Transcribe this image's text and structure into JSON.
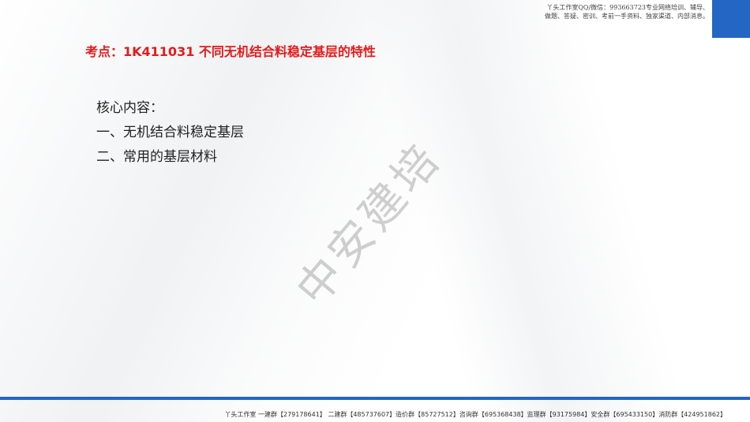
{
  "header": {
    "note_line1": "丫头工作室QQ/微信：993663723专业网络培训、辅导、",
    "note_line2": "做题、答疑、密训、考前一手资料、独家渠道、内部消息。"
  },
  "title": "考点：1K411031 不同无机结合料稳定基层的特性",
  "content": {
    "items": [
      "核心内容：",
      "一、无机结合料稳定基层",
      "二、常用的基层材料"
    ]
  },
  "watermark": "中安建培",
  "footer": "丫头工作室  一建群【279178641】 二建群【485737607】造价群【85727512】咨询群【695368438】监理群【93175984】安全群【695433150】消防群【424951862】",
  "colors": {
    "accent": "#2366c4",
    "title": "#e31b1b"
  }
}
